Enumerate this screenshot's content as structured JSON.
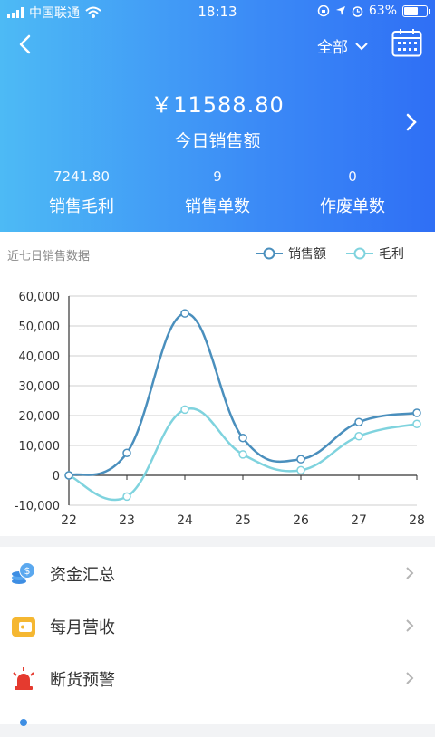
{
  "status": {
    "carrier": "中国联通",
    "time": "18:13",
    "battery": "63%"
  },
  "header": {
    "filter_label": "全部",
    "amount": "￥11588.80",
    "amount_label": "今日销售额",
    "stats": [
      {
        "value": "7241.80",
        "label": "销售毛利"
      },
      {
        "value": "9",
        "label": "销售单数"
      },
      {
        "value": "0",
        "label": "作废单数"
      }
    ]
  },
  "chart_data": {
    "type": "line",
    "title": "近七日销售数据",
    "categories": [
      "22",
      "23",
      "24",
      "25",
      "26",
      "27",
      "28"
    ],
    "series": [
      {
        "name": "销售额",
        "color": "#4a8fbd",
        "values": [
          0,
          7500,
          54200,
          12500,
          5400,
          17800,
          20900
        ]
      },
      {
        "name": "毛利",
        "color": "#7fd3de",
        "values": [
          0,
          -7100,
          22000,
          7000,
          1700,
          13100,
          17200
        ]
      }
    ],
    "yticks": [
      "60,000",
      "50,000",
      "40,000",
      "30,000",
      "20,000",
      "10,000",
      "0",
      "-10,000"
    ],
    "ylim": [
      -10000,
      60000
    ],
    "grid": true,
    "legend": "top-right"
  },
  "menu": [
    {
      "label": "资金汇总",
      "icon": "coins-icon"
    },
    {
      "label": "每月营收",
      "icon": "wallet-icon"
    },
    {
      "label": "断货预警",
      "icon": "alarm-icon"
    }
  ]
}
